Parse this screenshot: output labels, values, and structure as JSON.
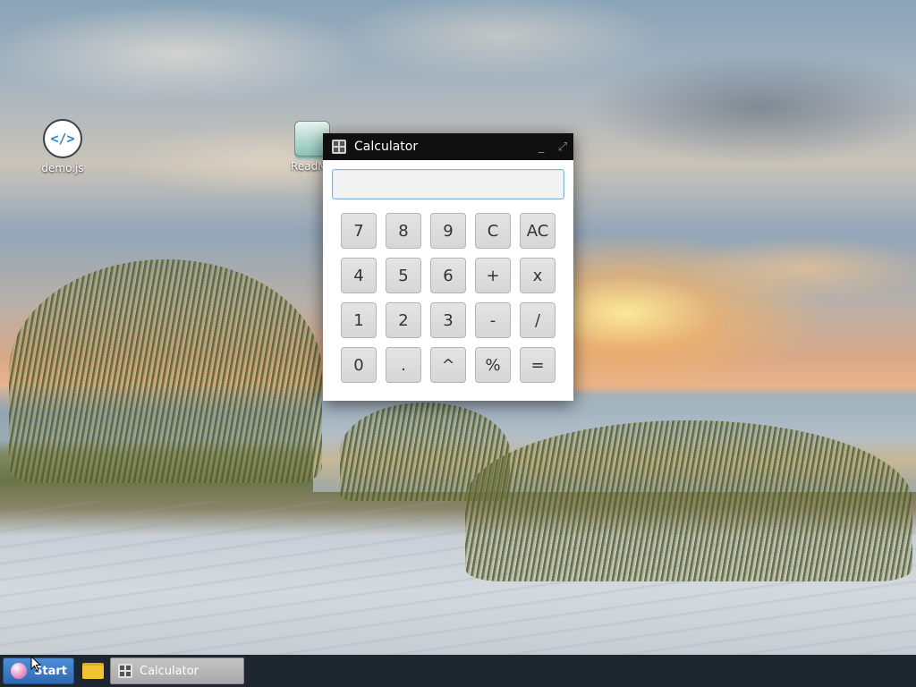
{
  "desktop": {
    "icons": [
      {
        "label": "demo.js",
        "icon": "code-file-icon"
      },
      {
        "label": "ReadMe",
        "icon": "readme-icon"
      }
    ]
  },
  "calculator": {
    "title": "Calculator",
    "display_value": "",
    "controls": {
      "minimize": "_",
      "maximize": "⤢"
    },
    "keys": [
      "7",
      "8",
      "9",
      "C",
      "AC",
      "4",
      "5",
      "6",
      "+",
      "x",
      "1",
      "2",
      "3",
      "-",
      "/",
      "0",
      ".",
      "^",
      "%",
      "="
    ]
  },
  "taskbar": {
    "start_label": "Start",
    "task_items": [
      {
        "label": "Calculator"
      }
    ]
  },
  "colors": {
    "titlebar": "#0f0f10",
    "taskbar": "#1e2630",
    "start_button": "#3a7cc7",
    "display_border": "#7fb8dd"
  }
}
